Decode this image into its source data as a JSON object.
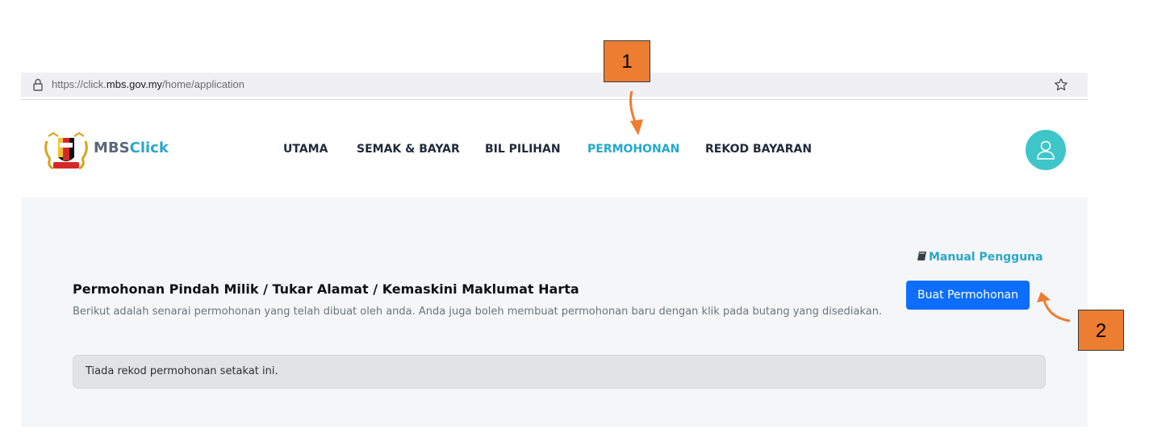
{
  "browser": {
    "url_prefix": "https://click.",
    "url_domain": "mbs.gov.my",
    "url_path": "/home/application"
  },
  "header": {
    "brand_part1": "MBS",
    "brand_part2": "Click",
    "logo_icon": "mbs-crest-icon",
    "nav": [
      {
        "label": "UTAMA",
        "active": false
      },
      {
        "label": "SEMAK & BAYAR",
        "active": false
      },
      {
        "label": "BIL PILIHAN",
        "active": false
      },
      {
        "label": "PERMOHONAN",
        "active": true
      },
      {
        "label": "REKOD BAYARAN",
        "active": false
      }
    ],
    "avatar_icon": "user-icon"
  },
  "main": {
    "manual_label": "Manual Pengguna",
    "manual_icon": "book-icon",
    "title": "Permohonan Pindah Milik / Tukar Alamat / Kemaskini Maklumat Harta",
    "description": "Berikut adalah senarai permohonan yang telah dibuat oleh anda. Anda juga boleh membuat permohonan baru dengan klik pada butang yang disediakan.",
    "create_button": "Buat Permohonan",
    "empty_message": "Tiada rekod permohonan setakat ini."
  },
  "annotations": [
    {
      "label": "1"
    },
    {
      "label": "2"
    }
  ],
  "colors": {
    "accent": "#24a8cc",
    "primary_button": "#0d6efd",
    "callout": "#ed7d31",
    "avatar": "#3ec6c8"
  }
}
